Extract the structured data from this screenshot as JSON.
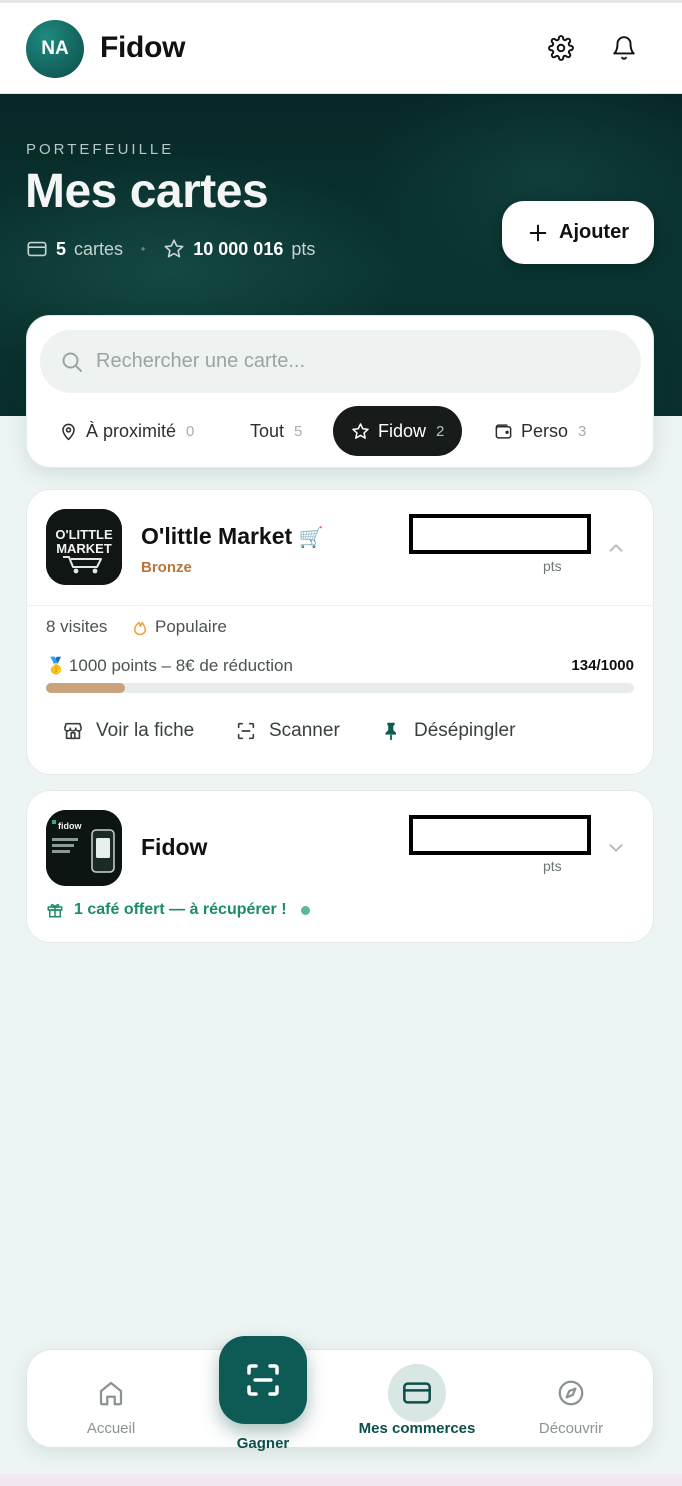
{
  "header": {
    "avatar_initials": "NA",
    "app_name": "Fidow",
    "settings_icon": "gear-icon",
    "notifications_icon": "bell-icon"
  },
  "hero": {
    "overline": "PORTEFEUILLE",
    "title": "Mes cartes",
    "cards_count": "5",
    "cards_label": "cartes",
    "points_value": "10 000 016",
    "points_label": "pts",
    "add_button_label": "Ajouter"
  },
  "search": {
    "placeholder": "Rechercher une carte..."
  },
  "filters": [
    {
      "label": "À proximité",
      "count": "0",
      "icon": "location-pin-icon",
      "active": false
    },
    {
      "label": "Tout",
      "count": "5",
      "icon": "",
      "active": false
    },
    {
      "label": "Fidow",
      "count": "2",
      "icon": "star-icon",
      "active": true
    },
    {
      "label": "Perso",
      "count": "3",
      "icon": "wallet-icon",
      "active": false
    }
  ],
  "cards": [
    {
      "name": "O'little Market",
      "name_emoji": "🛒",
      "tier": "Bronze",
      "points_label": "pts",
      "expanded": true,
      "visits": "8 visites",
      "popularity": "Populaire",
      "reward_emoji": "🥇",
      "reward_text": "1000 points – 8€ de réduction",
      "progress_text": "134/1000",
      "progress_fraction": 0.134,
      "logo_text_line1": "O'LITTLE",
      "logo_text_line2": "MARKET",
      "actions": {
        "view": "Voir la fiche",
        "scan": "Scanner",
        "unpin": "Désépingler"
      }
    },
    {
      "name": "Fidow",
      "points_label": "pts",
      "expanded": false,
      "logo_text": "fidow",
      "reward_banner": "1 café offert — à récupérer !"
    }
  ],
  "bottom_nav": {
    "home_label": "Accueil",
    "scan_label": "Gagner",
    "merchants_label": "Mes commerces",
    "discover_label": "Découvrir"
  },
  "colors": {
    "brand_dark": "#0e5a54",
    "hero_bg": "#0a3431",
    "tier_bronze": "#b7773b",
    "progress_fill": "#c9a37c",
    "reward_green": "#1b8c6a",
    "page_bg": "#edf5f4"
  }
}
